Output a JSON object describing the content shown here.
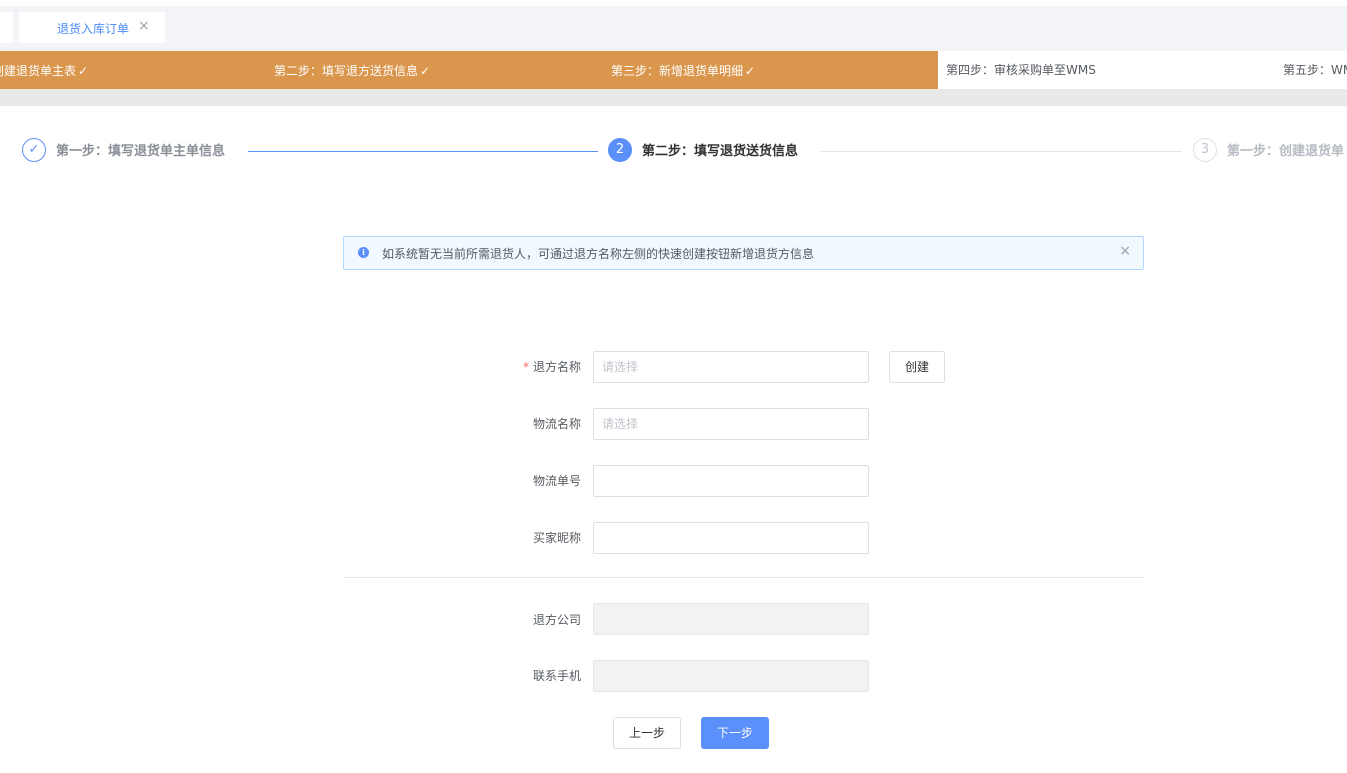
{
  "tabs": [
    {
      "label": "退货入库订单"
    }
  ],
  "flow": {
    "steps": [
      {
        "label": "创建退货单主表",
        "done": true
      },
      {
        "label": "第二步：填写退方送货信息",
        "done": true
      },
      {
        "label": "第三步：新增退货单明细",
        "done": true
      },
      {
        "label": "第四步：审核采购单至WMS",
        "done": false
      },
      {
        "label": "第五步：WMS",
        "done": false
      }
    ],
    "check": "✓",
    "colors": {
      "done": "#db964e"
    }
  },
  "steps": [
    {
      "icon": "✓",
      "title": "第一步：填写退货单主单信息",
      "status": "finish"
    },
    {
      "icon": "2",
      "title": "第二步：填写退货送货信息",
      "status": "process"
    },
    {
      "icon": "3",
      "title": "第一步：创建退货单",
      "status": "wait"
    }
  ],
  "alert": {
    "icon": "i",
    "text": "如系统暂无当前所需退货人，可通过退方名称左侧的快速创建按钮新增退货方信息",
    "close": "×"
  },
  "form": {
    "returner_name": {
      "label": "退方名称",
      "required_mark": "*",
      "placeholder": "请选择",
      "value": ""
    },
    "create_button": "创建",
    "logistics_name": {
      "label": "物流名称",
      "placeholder": "请选择",
      "value": ""
    },
    "logistics_no": {
      "label": "物流单号",
      "value": ""
    },
    "buyer_nick": {
      "label": "买家昵称",
      "value": ""
    },
    "returner_company": {
      "label": "退方公司",
      "value": ""
    },
    "contact_phone": {
      "label": "联系手机",
      "value": ""
    }
  },
  "buttons": {
    "prev": "上一步",
    "next": "下一步"
  },
  "tab_close": "×",
  "colors": {
    "primary": "#5b8ff9",
    "accent": "#db964e"
  }
}
